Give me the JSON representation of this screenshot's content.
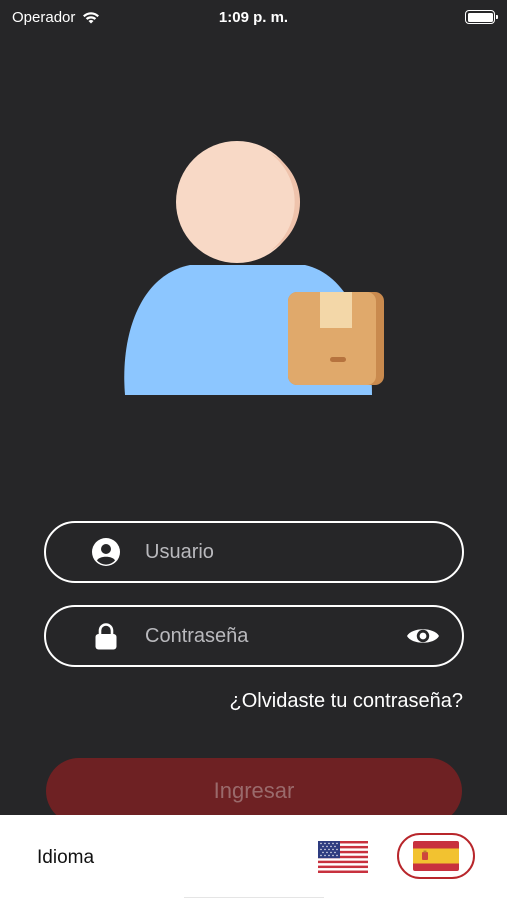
{
  "status_bar": {
    "carrier": "Operador",
    "time": "1:09 p. m.",
    "icons": [
      "wifi-icon",
      "battery-icon"
    ]
  },
  "hero": {
    "icon": "courier-user-with-box-icon",
    "colors": {
      "head": "#F8D9C6",
      "body": "#8CC6FF",
      "box": "#E0A96B",
      "box_tape": "#F3D7A8"
    }
  },
  "login_form": {
    "username": {
      "placeholder": "Usuario",
      "value": "",
      "icon": "user-circle-icon"
    },
    "password": {
      "placeholder": "Contraseña",
      "value": "",
      "icon": "lock-icon",
      "toggle_icon": "eye-icon"
    },
    "forgot_password_label": "¿Olvidaste tu contraseña?",
    "submit_label": "Ingresar"
  },
  "language_bar": {
    "label": "Idioma",
    "options": [
      {
        "code": "en",
        "icon": "us-flag-icon",
        "selected": false
      },
      {
        "code": "es",
        "icon": "spain-flag-icon",
        "selected": true
      }
    ]
  },
  "colors": {
    "background": "#262628",
    "accent": "#B8262B",
    "button_bg": "#6E2123"
  }
}
